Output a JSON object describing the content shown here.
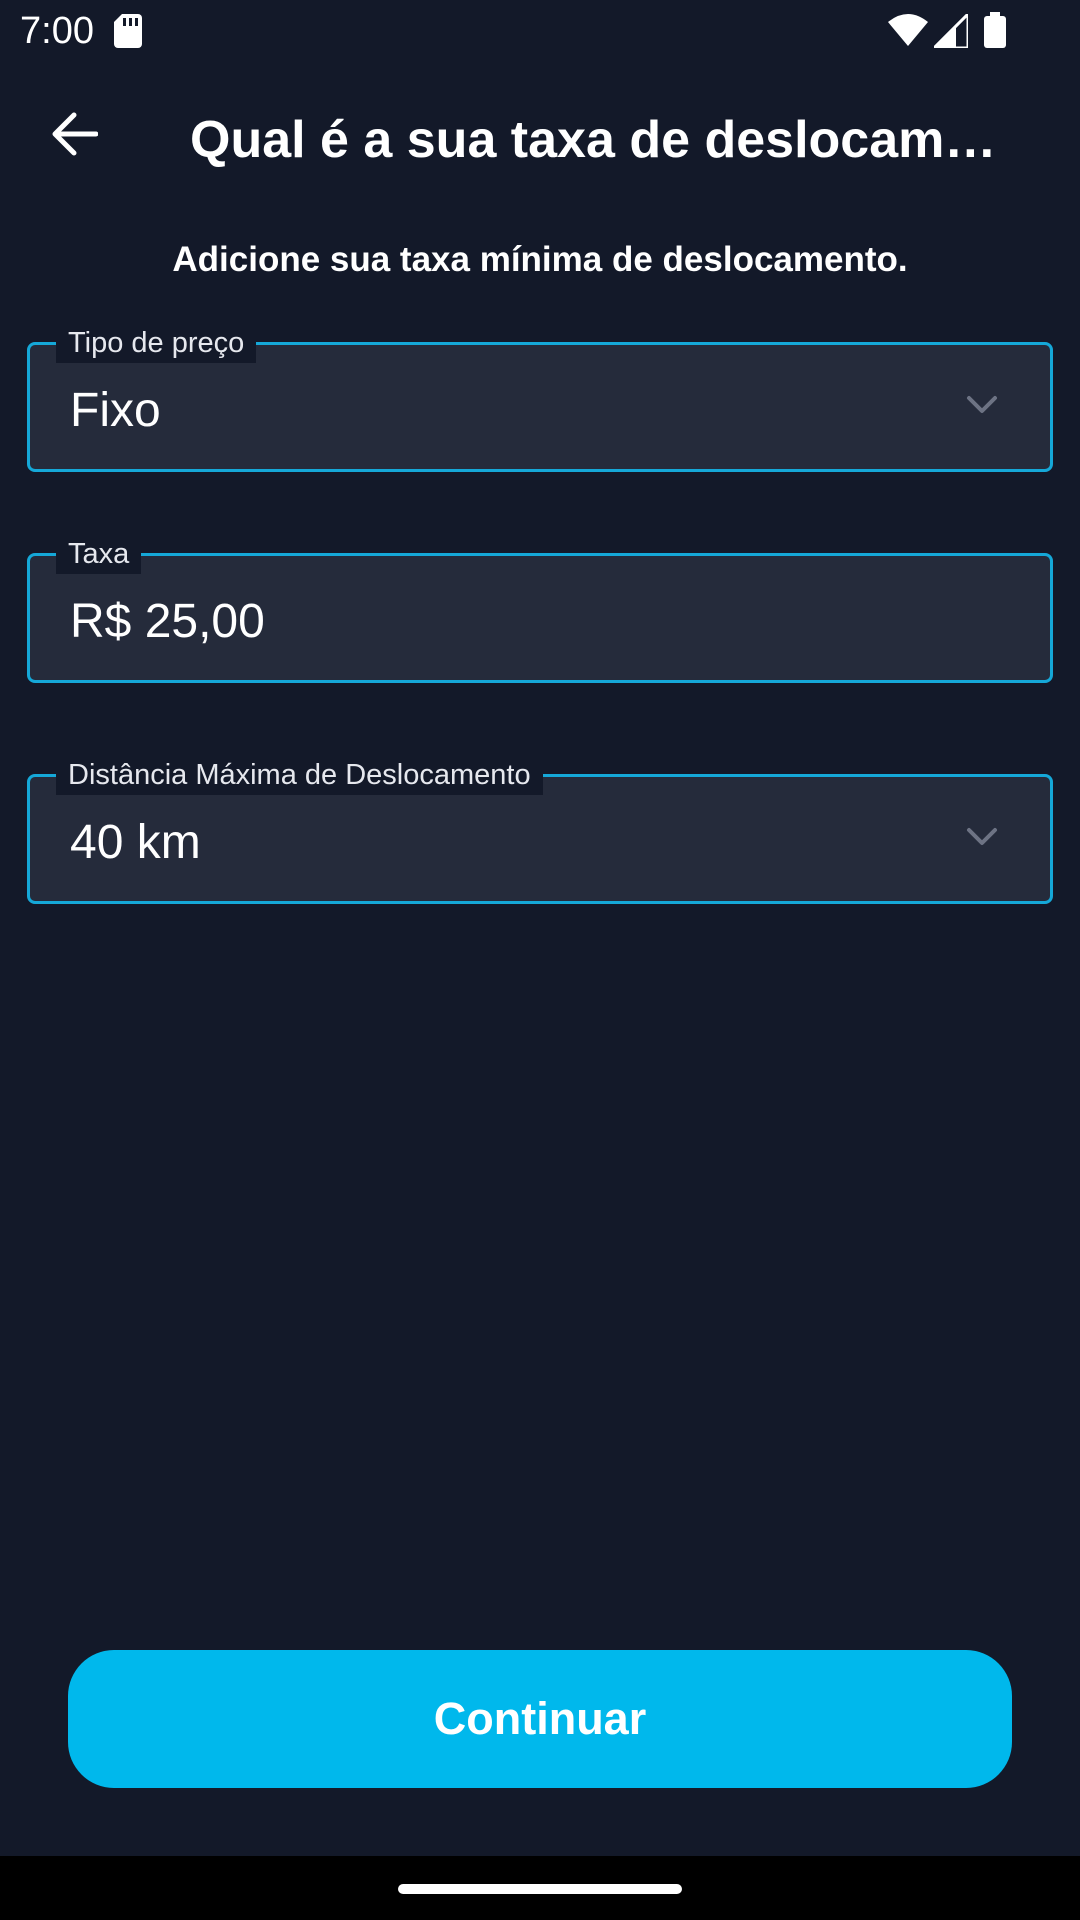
{
  "status_bar": {
    "time": "7:00",
    "icons": [
      "sd-card-icon",
      "wifi-icon",
      "signal-icon",
      "battery-icon"
    ]
  },
  "app_bar": {
    "back_icon": "arrow-back-icon",
    "title": "Qual é a sua taxa de deslocamen…"
  },
  "subtitle": "Adicione sua taxa mínima de deslocamento.",
  "fields": {
    "price_type": {
      "label": "Tipo de preço",
      "value": "Fixo",
      "icon": "chevron-down-icon"
    },
    "fee": {
      "label": "Taxa",
      "value": "R$ 25,00"
    },
    "max_distance": {
      "label": "Distância Máxima de Deslocamento",
      "value": "40 km",
      "icon": "chevron-down-icon"
    }
  },
  "continue_button": {
    "label": "Continuar"
  },
  "colors": {
    "background": "#131929",
    "field_background": "#252b3b",
    "field_border": "#15a8d8",
    "accent": "#00b8ec"
  }
}
